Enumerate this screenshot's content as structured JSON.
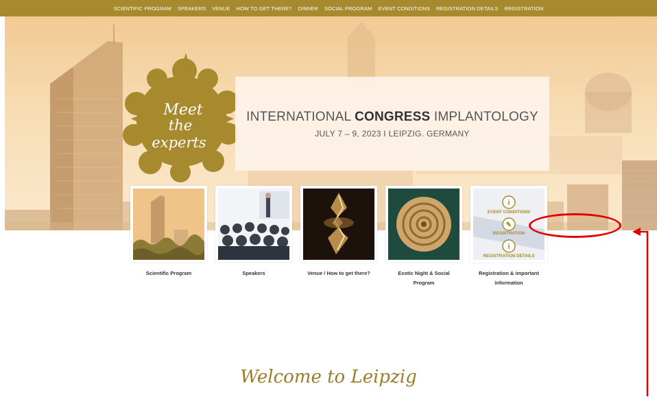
{
  "nav": {
    "items": [
      "SCIENTIFIC PROGRAM",
      "SPEAKERS",
      "VENUE",
      "HOW TO GET THERE?",
      "DINNER",
      "SOCIAL PROGRAM",
      "EVENT CONDITIONS",
      "REGISTRATION DETAILS",
      "REGISTRATION"
    ]
  },
  "hero": {
    "badge_line1": "Meet",
    "badge_line2": "the",
    "badge_line3": "experts",
    "title_pre": "INTERNATIONAL ",
    "title_bold": "CONGRESS",
    "title_post": " IMPLANTOLOGY",
    "subtitle": "JULY 7 – 9, 2023 I LEIPZIG. GERMANY"
  },
  "cards": [
    {
      "label": "Scientific Program"
    },
    {
      "label": "Speakers"
    },
    {
      "label": "Venue / How to get there?"
    },
    {
      "label": "Exotic Night & Social Program"
    },
    {
      "label": "Registration & important information"
    }
  ],
  "registration_thumb": {
    "item1": "EVENT CONDITIONS",
    "item2": "REGISTRATION",
    "item3": "REGISTRATION DETAILS",
    "icon1": "info-icon",
    "icon2": "pencil-icon",
    "icon3": "info-icon"
  },
  "welcome": "Welcome to Leipzig",
  "colors": {
    "nav_bg": "#a68a2d",
    "gold": "#a68a2d",
    "annotation": "#e00000"
  }
}
